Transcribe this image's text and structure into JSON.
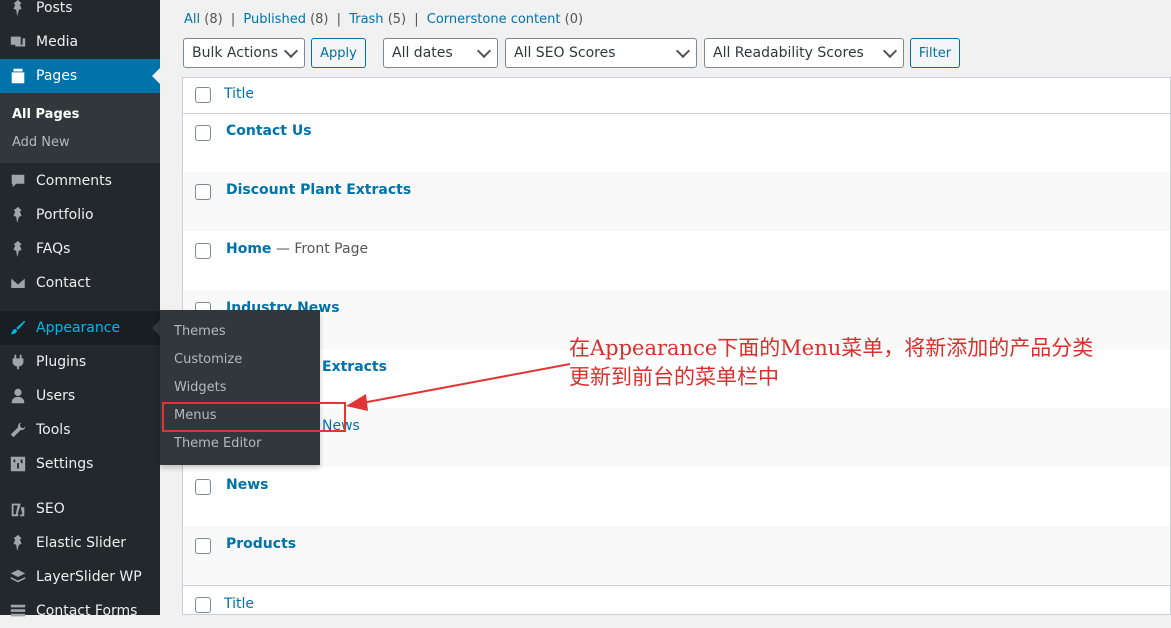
{
  "sidebar": {
    "items": [
      {
        "label": "Posts",
        "icon": "pin-icon"
      },
      {
        "label": "Media",
        "icon": "media-icon"
      },
      {
        "label": "Pages",
        "icon": "pages-icon"
      },
      {
        "label": "Comments",
        "icon": "comments-icon"
      },
      {
        "label": "Portfolio",
        "icon": "pin-icon"
      },
      {
        "label": "FAQs",
        "icon": "pin-icon"
      },
      {
        "label": "Contact",
        "icon": "envelope-icon"
      },
      {
        "label": "Appearance",
        "icon": "brush-icon"
      },
      {
        "label": "Plugins",
        "icon": "plugin-icon"
      },
      {
        "label": "Users",
        "icon": "user-icon"
      },
      {
        "label": "Tools",
        "icon": "wrench-icon"
      },
      {
        "label": "Settings",
        "icon": "settings-icon"
      },
      {
        "label": "SEO",
        "icon": "yoast-icon"
      },
      {
        "label": "Elastic Slider",
        "icon": "pin-icon"
      },
      {
        "label": "LayerSlider WP",
        "icon": "layers-icon"
      },
      {
        "label": "Contact Forms",
        "icon": "forms-icon"
      }
    ],
    "pages_submenu": [
      "All Pages",
      "Add New"
    ]
  },
  "appearance_flyout": [
    "Themes",
    "Customize",
    "Widgets",
    "Menus",
    "Theme Editor"
  ],
  "filters": {
    "all": "All",
    "all_count": "(8)",
    "published": "Published",
    "published_count": "(8)",
    "trash": "Trash",
    "trash_count": "(5)",
    "cornerstone": "Cornerstone content",
    "cornerstone_count": "(0)",
    "sep": "|"
  },
  "toolbar": {
    "bulk_actions": "Bulk Actions",
    "apply": "Apply",
    "dates": "All dates",
    "seo": "All SEO Scores",
    "readability": "All Readability Scores",
    "filter": "Filter"
  },
  "table": {
    "column_title": "Title",
    "rows": [
      {
        "title": "Contact Us",
        "state": ""
      },
      {
        "title": "Discount Plant Extracts",
        "state": ""
      },
      {
        "title": "Home",
        "state": " — Front Page"
      },
      {
        "title": "Industry News",
        "state": ""
      },
      {
        "title": "Extracts",
        "state": ""
      },
      {
        "title": "News",
        "state": ""
      },
      {
        "title": "News",
        "state": ""
      },
      {
        "title": "Products",
        "state": ""
      }
    ]
  },
  "annotation": {
    "line1": "在Appearance下面的Menu菜单，将新添加的产品分类",
    "line2": "更新到前台的菜单栏中",
    "color": "#d9302c"
  },
  "colors": {
    "sidebar_bg": "#23282d",
    "accent": "#0073aa",
    "highlight": "#00b9eb"
  }
}
